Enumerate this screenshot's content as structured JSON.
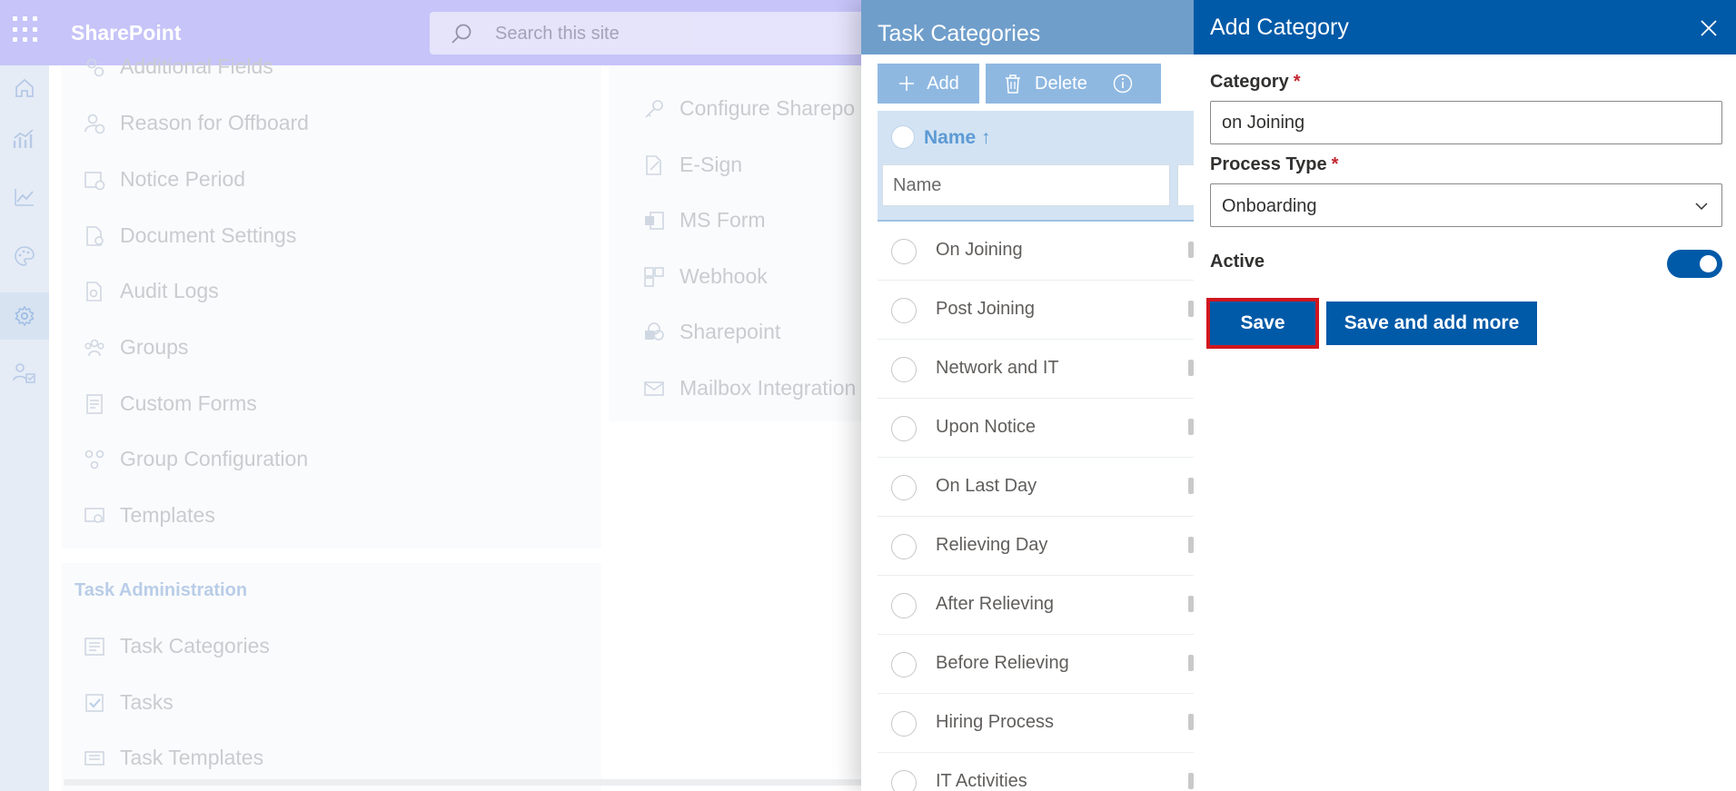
{
  "suite": {
    "brand": "SharePoint",
    "search_placeholder": "Search this site"
  },
  "rail": {
    "icons": [
      "home-icon",
      "growth-chart-icon",
      "trend-chart-icon",
      "palette-icon",
      "gear-icon",
      "user-tasks-icon"
    ]
  },
  "settings": {
    "left_items": [
      "Additional Fields",
      "Reason for Offboard",
      "Notice Period",
      "Document Settings",
      "Audit Logs",
      "Groups",
      "Custom Forms",
      "Group Configuration",
      "Templates"
    ],
    "right_items": [
      "Configure Sharepo",
      "E-Sign",
      "MS Form",
      "Webhook",
      "Sharepoint",
      "Mailbox Integration"
    ],
    "task_admin": {
      "heading": "Task Administration",
      "items": [
        "Task Categories",
        "Tasks",
        "Task Templates"
      ]
    }
  },
  "task_categories": {
    "title": "Task Categories",
    "add_label": "Add",
    "delete_label": "Delete",
    "column_name": "Name",
    "filter_placeholder": "Name",
    "rows": [
      "On Joining",
      "Post Joining",
      "Network and IT",
      "Upon Notice",
      "On Last Day",
      "Relieving Day",
      "After Relieving",
      "Before Relieving",
      "Hiring Process",
      "IT Activities"
    ]
  },
  "add_category": {
    "title": "Add Category",
    "category_label": "Category",
    "category_value": "on Joining",
    "process_type_label": "Process Type",
    "process_type_value": "Onboarding",
    "required_mark": "*",
    "active_label": "Active",
    "active": true,
    "save_label": "Save",
    "save_more_label": "Save and add more"
  },
  "colors": {
    "suite_bar": "#c6c4f8",
    "panel_header": "#005aa8",
    "highlight_outline": "#d0161f"
  }
}
